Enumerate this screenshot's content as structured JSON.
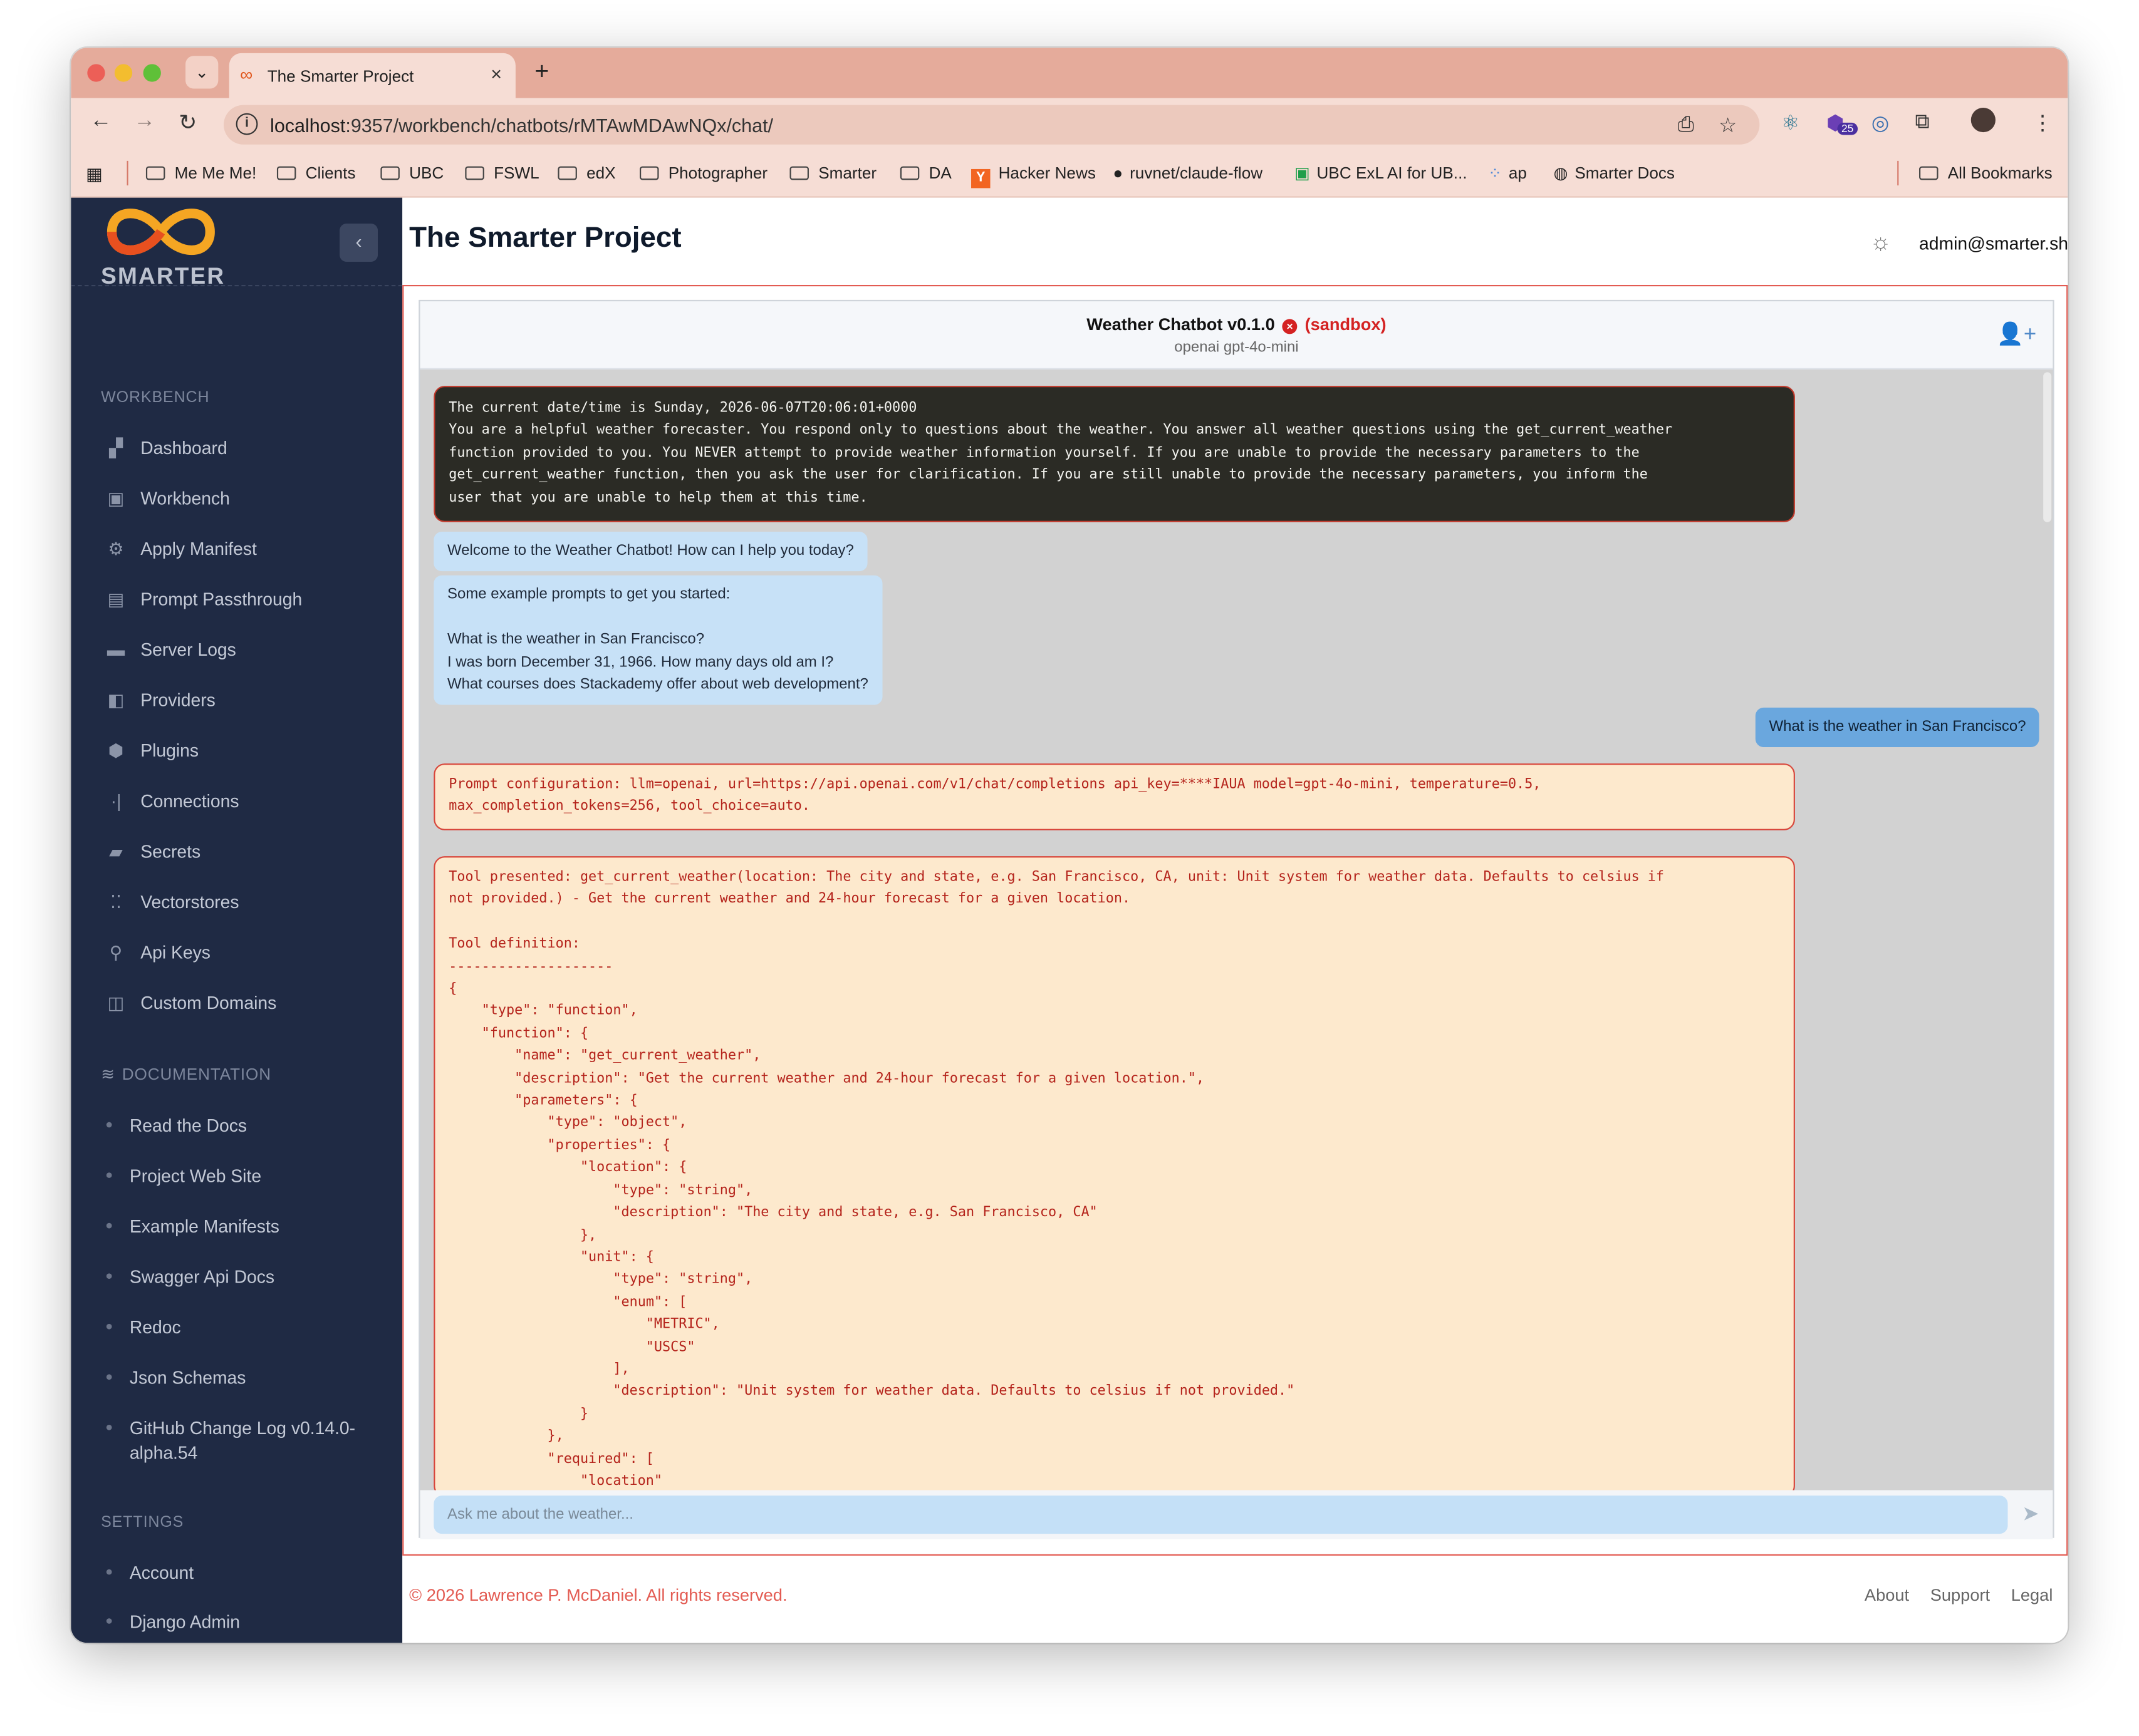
{
  "browser": {
    "tab_title": "The Smarter Project",
    "url_host": "localhost",
    "url_rest": ":9357/workbench/chatbots/rMTAwMDAwNQx/chat/",
    "ext_badge": "25",
    "bookmarks": [
      "Me Me Me!",
      "Clients",
      "UBC",
      "FSWL",
      "edX",
      "Photographer",
      "Smarter",
      "DA",
      "Hacker News",
      "ruvnet/claude-flow",
      "UBC ExL AI for UB...",
      "ap",
      "Smarter Docs"
    ],
    "all_bookmarks": "All Bookmarks"
  },
  "sidebar": {
    "logo_text": "SMARTER",
    "workbench_label": "WORKBENCH",
    "workbench_items": [
      "Dashboard",
      "Workbench",
      "Apply Manifest",
      "Prompt Passthrough",
      "Server Logs",
      "Providers",
      "Plugins",
      "Connections",
      "Secrets",
      "Vectorstores",
      "Api Keys",
      "Custom Domains"
    ],
    "documentation_label": "DOCUMENTATION",
    "documentation_items": [
      "Read the Docs",
      "Project Web Site",
      "Example Manifests",
      "Swagger Api Docs",
      "Redoc",
      "Json Schemas",
      "GitHub Change Log v0.14.0-alpha.54"
    ],
    "settings_label": "SETTINGS",
    "settings_items": [
      "Account",
      "Django Admin"
    ]
  },
  "header": {
    "title": "The Smarter Project",
    "user": "admin@smarter.sh"
  },
  "chat": {
    "title": "Weather Chatbot v0.1.0",
    "sandbox": "(sandbox)",
    "subtitle": "openai gpt-4o-mini",
    "system_prompt": "The current date/time is Sunday, 2026-06-07T20:06:01+0000\nYou are a helpful weather forecaster. You respond only to questions about the weather. You answer all weather questions using the get_current_weather\nfunction provided to you. You NEVER attempt to provide weather information yourself. If you are unable to provide the necessary parameters to the\nget_current_weather function, then you ask the user for clarification. If you are still unable to provide the necessary parameters, you inform the\nuser that you are unable to help them at this time.",
    "welcome": "Welcome to the Weather Chatbot! How can I help you today?",
    "examples": "Some example prompts to get you started:\n\nWhat is the weather in San Francisco?\nI was born December 31, 1966. How many days old am I?\nWhat courses does Stackademy offer about web development?",
    "user_message": "What is the weather in San Francisco?",
    "prompt_config": "Prompt configuration: llm=openai, url=https://api.openai.com/v1/chat/completions api_key=****IAUA model=gpt-4o-mini, temperature=0.5,\nmax_completion_tokens=256, tool_choice=auto.",
    "tool_presented": "Tool presented: get_current_weather(location: The city and state, e.g. San Francisco, CA, unit: Unit system for weather data. Defaults to celsius if\nnot provided.) - Get the current weather and 24-hour forecast for a given location.\n\nTool definition:\n--------------------\n{\n    \"type\": \"function\",\n    \"function\": {\n        \"name\": \"get_current_weather\",\n        \"description\": \"Get the current weather and 24-hour forecast for a given location.\",\n        \"parameters\": {\n            \"type\": \"object\",\n            \"properties\": {\n                \"location\": {\n                    \"type\": \"string\",\n                    \"description\": \"The city and state, e.g. San Francisco, CA\"\n                },\n                \"unit\": {\n                    \"type\": \"string\",\n                    \"enum\": [\n                        \"METRIC\",\n                        \"USCS\"\n                    ],\n                    \"description\": \"Unit system for weather data. Defaults to celsius if not provided.\"\n                }\n            },\n            \"required\": [\n                \"location\"",
    "input_placeholder": "Ask me about the weather..."
  },
  "footer": {
    "copyright": "© 2026 Lawrence P. McDaniel. All rights reserved.",
    "about": "About",
    "support": "Support",
    "legal": "Legal"
  }
}
